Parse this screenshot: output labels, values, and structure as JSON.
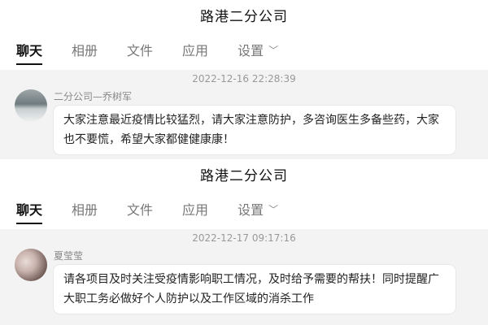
{
  "screens": [
    {
      "title": "路港二分公司",
      "tabs": [
        "聊天",
        "相册",
        "文件",
        "应用",
        "设置"
      ],
      "message": {
        "timestamp": "2022-12-16 22:28:39",
        "sender": "二分公司—乔树军",
        "text": "大家注意最近疫情比较猛烈，请大家注意防护，多咨询医生多备些药，大家也不要慌，希望大家都健健康康！"
      }
    },
    {
      "title": "路港二分公司",
      "tabs": [
        "聊天",
        "相册",
        "文件",
        "应用",
        "设置"
      ],
      "message": {
        "timestamp": "2022-12-17 09:17:16",
        "sender": "夏莹莹",
        "text": "请各项目及时关注受疫情影响职工情况，及时给予需要的帮扶！同时提醒广大职工务必做好个人防护以及工作区域的消杀工作"
      }
    }
  ]
}
